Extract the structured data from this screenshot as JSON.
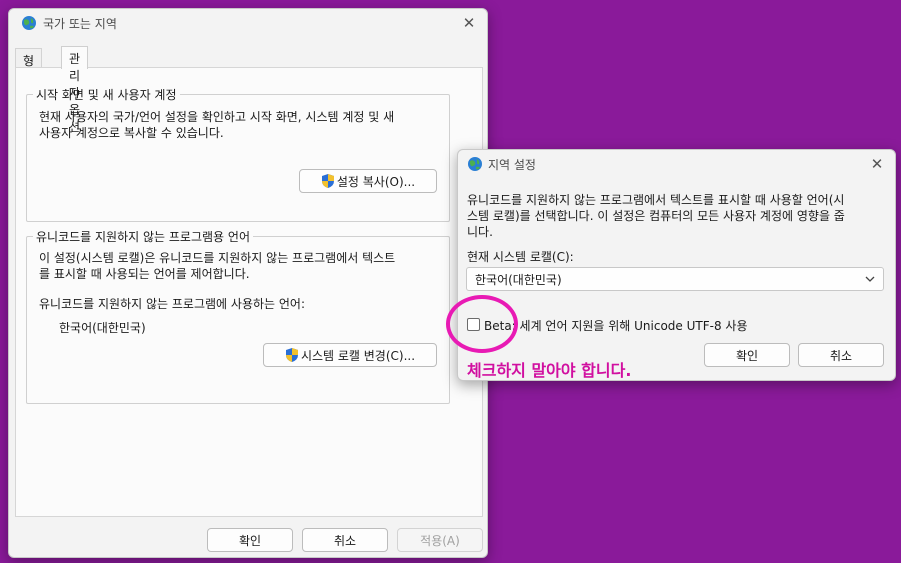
{
  "main_window": {
    "title": "국가 또는 지역",
    "tabs": [
      {
        "label": "형식"
      },
      {
        "label": "관리자 옵션"
      }
    ],
    "welcome_group": {
      "legend": "시작 화면 및 새 사용자 계정",
      "desc_line1": "현재 사용자의 국가/언어 설정을 확인하고 시작 화면, 시스템 계정 및 새",
      "desc_line2": "사용자 계정으로 복사할 수 있습니다.",
      "button": "설정 복사(O)..."
    },
    "unicode_group": {
      "legend": "유니코드를 지원하지 않는 프로그램용 언어",
      "desc_line1": "이 설정(시스템 로캘)은 유니코드를 지원하지 않는 프로그램에서 텍스트",
      "desc_line2": "를 표시할 때 사용되는 언어를 제어합니다.",
      "current_label": "유니코드를 지원하지 않는 프로그램에 사용하는 언어:",
      "current_value": "한국어(대한민국)",
      "button": "시스템 로캘 변경(C)..."
    },
    "footer": {
      "ok": "확인",
      "cancel": "취소",
      "apply": "적용(A)"
    }
  },
  "region_dialog": {
    "title": "지역 설정",
    "desc_line1": "유니코드를 지원하지 않는 프로그램에서 텍스트를 표시할 때 사용할 언어(시",
    "desc_line2": "스템 로캘)를 선택합니다. 이 설정은 컴퓨터의 모든 사용자 계정에 영향을 줍",
    "desc_line3": "니다.",
    "locale_label": "현재 시스템 로캘(C):",
    "locale_value": "한국어(대한민국)",
    "beta_checkbox": {
      "checked": false,
      "label": "Beta: 세계 언어 지원을 위해 Unicode UTF-8 사용"
    },
    "ok": "확인",
    "cancel": "취소"
  },
  "annotation": {
    "text": "체크하지 말아야 합니다.",
    "color": "#e81ab4"
  },
  "icons": [
    "globe-icon",
    "close-icon",
    "shield-icon",
    "chevron-down-icon"
  ]
}
